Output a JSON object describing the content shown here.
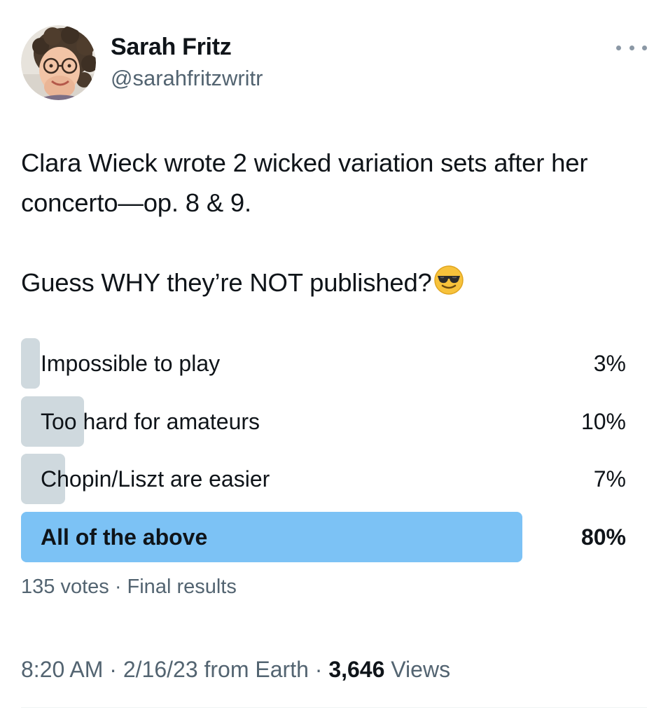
{
  "author": {
    "display_name": "Sarah Fritz",
    "handle": "@sarahfritzwritr",
    "avatar_icon": "profile-photo"
  },
  "more_icon": "more-horizontal-icon",
  "tweet": {
    "paragraphs": [
      "Clara Wieck wrote 2 wicked variation sets after her concerto—op. 8 & 9.",
      "Guess WHY they’re NOT published?"
    ],
    "emoji": "smiling-face-with-sunglasses-icon"
  },
  "poll": {
    "options": [
      {
        "label": "Impossible to play",
        "percent_text": "3%",
        "percent": 3,
        "winner": false
      },
      {
        "label": "Too hard for amateurs",
        "percent_text": "10%",
        "percent": 10,
        "winner": false
      },
      {
        "label": "Chopin/Liszt are easier",
        "percent_text": "7%",
        "percent": 7,
        "winner": false
      },
      {
        "label": "All of the above",
        "percent_text": "80%",
        "percent": 80,
        "winner": true
      }
    ],
    "votes_text": "135 votes · Final results"
  },
  "footer": {
    "time_text": "8:20 AM · 2/16/23 from Earth · ",
    "views_count": "3,646",
    "views_label": " Views"
  },
  "colors": {
    "text_primary": "#0f1419",
    "text_secondary": "#536471",
    "poll_bar": "#cfd9de",
    "poll_bar_winner": "#7cc2f5"
  }
}
